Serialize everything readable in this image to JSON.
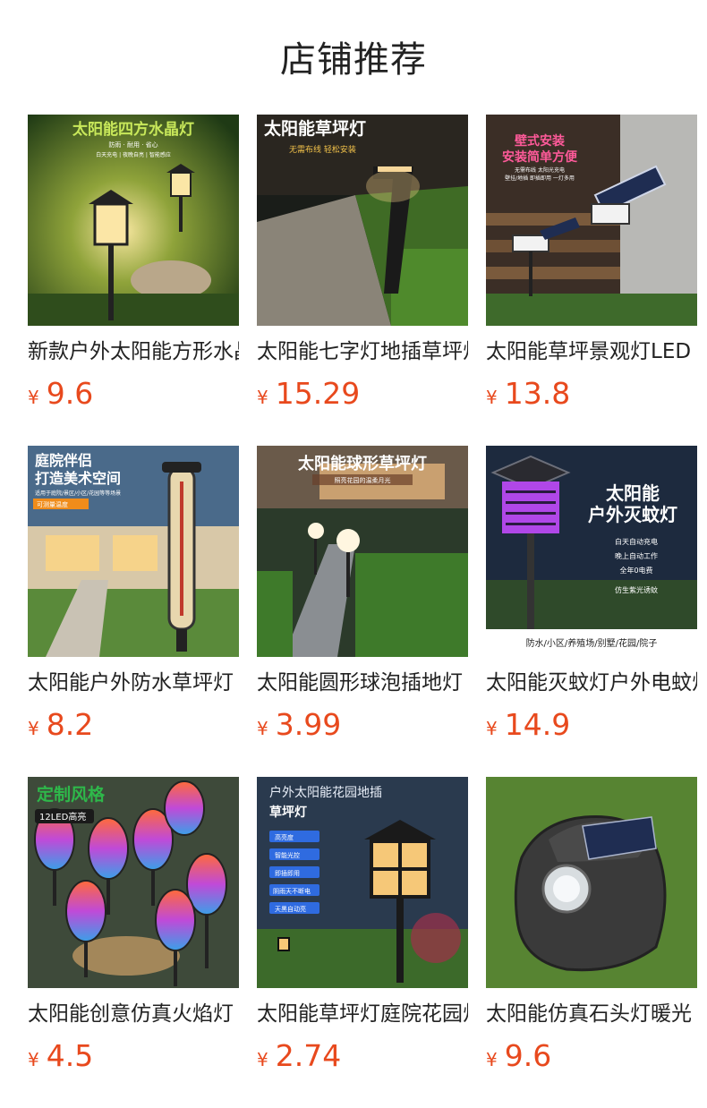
{
  "header": {
    "title": "店铺推荐"
  },
  "currency": "¥",
  "products": [
    {
      "name": "新款户外太阳能方形水晶灯",
      "price": "9.6",
      "overlay": [
        "太阳能四方水晶灯",
        "防雨 · 耐用 · 省心",
        "白天充电 | 夜晚自亮 | 智能感应"
      ]
    },
    {
      "name": "太阳能七字灯地插草坪灯",
      "price": "15.29",
      "overlay": [
        "太阳能草坪灯",
        "无需布线 轻松安装"
      ]
    },
    {
      "name": "太阳能草坪景观灯LED",
      "price": "13.8",
      "overlay": [
        "壁式安装",
        "安装简单方便",
        "无需布线 太阳光充电",
        "壁挂/地插 即插即用 一灯多用"
      ]
    },
    {
      "name": "太阳能户外防水草坪灯",
      "price": "8.2",
      "overlay": [
        "庭院伴侣",
        "打造美术空间",
        "适用于庭院/景区/小区/花园等等场景",
        "可测量温度"
      ]
    },
    {
      "name": "太阳能圆形球泡插地灯",
      "price": "3.99",
      "overlay": [
        "太阳能球形草坪灯",
        "照亮花园的温柔月光"
      ]
    },
    {
      "name": "太阳能灭蚊灯户外电蚊灯",
      "price": "14.9",
      "overlay": [
        "太阳能",
        "户外灭蚊灯",
        "白天自动充电",
        "晚上自动工作",
        "全年0电费",
        "仿生紫光诱蚊",
        "防水/小区/养殖场/别墅/花园/院子"
      ]
    },
    {
      "name": "太阳能创意仿真火焰灯",
      "price": "4.5",
      "overlay": [
        "定制风格",
        "12LED高亮"
      ]
    },
    {
      "name": "太阳能草坪灯庭院花园灯",
      "price": "2.74",
      "overlay": [
        "户外太阳能花园地插",
        "草坪灯",
        "高亮度",
        "智能光控",
        "即插即用",
        "阴雨天不断电",
        "天黑自动亮"
      ]
    },
    {
      "name": "太阳能仿真石头灯暖光",
      "price": "9.6",
      "overlay": []
    }
  ]
}
